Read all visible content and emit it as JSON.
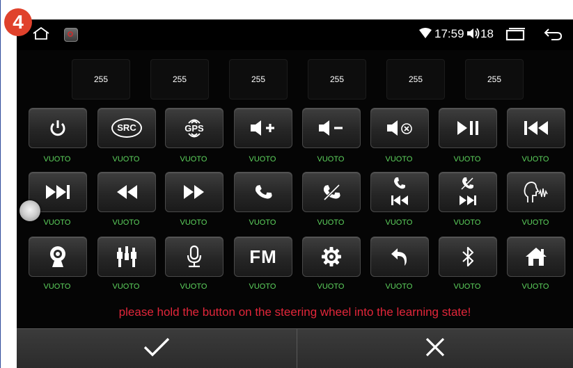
{
  "step_badge": "4",
  "status_bar": {
    "time": "17:59",
    "volume": "18",
    "icons": [
      "home-icon",
      "app-icon",
      "wifi-icon",
      "volume-icon",
      "recent-apps-icon",
      "back-icon"
    ]
  },
  "slots": [
    "255",
    "255",
    "255",
    "255",
    "255",
    "255"
  ],
  "rows": [
    [
      {
        "icon": "power-icon",
        "label": "VUOTO"
      },
      {
        "icon": "src-icon",
        "label": "VUOTO",
        "text": "SRC"
      },
      {
        "icon": "gps-icon",
        "label": "VUOTO",
        "text": "GPS"
      },
      {
        "icon": "volume-up-icon",
        "label": "VUOTO"
      },
      {
        "icon": "volume-down-icon",
        "label": "VUOTO"
      },
      {
        "icon": "mute-icon",
        "label": "VUOTO"
      },
      {
        "icon": "play-pause-icon",
        "label": "VUOTO"
      },
      {
        "icon": "previous-track-icon",
        "label": "VUOTO"
      }
    ],
    [
      {
        "icon": "next-track-icon",
        "label": "VUOTO"
      },
      {
        "icon": "rewind-icon",
        "label": "VUOTO"
      },
      {
        "icon": "fast-forward-icon",
        "label": "VUOTO"
      },
      {
        "icon": "phone-answer-icon",
        "label": "VUOTO"
      },
      {
        "icon": "phone-hangup-icon",
        "label": "VUOTO"
      },
      {
        "icon": "phone-previous-icon",
        "label": "VUOTO"
      },
      {
        "icon": "phone-next-icon",
        "label": "VUOTO"
      },
      {
        "icon": "voice-command-icon",
        "label": "VUOTO"
      }
    ],
    [
      {
        "icon": "camera-icon",
        "label": "VUOTO"
      },
      {
        "icon": "rca-av-icon",
        "label": "VUOTO"
      },
      {
        "icon": "microphone-icon",
        "label": "VUOTO"
      },
      {
        "icon": "fm-radio-icon",
        "label": "VUOTO",
        "text": "FM"
      },
      {
        "icon": "settings-gear-icon",
        "label": "VUOTO"
      },
      {
        "icon": "return-icon",
        "label": "VUOTO"
      },
      {
        "icon": "bluetooth-icon",
        "label": "VUOTO"
      },
      {
        "icon": "home-icon",
        "label": "VUOTO"
      }
    ]
  ],
  "hint_text": "please hold the button on the steering wheel into the learning state!",
  "bottom_bar": {
    "confirm_icon": "checkmark-icon",
    "cancel_icon": "close-icon"
  },
  "colors": {
    "label_green": "#5dd35d",
    "hint_red": "#e2263a",
    "badge": "#e0422c",
    "background": "#050505"
  }
}
